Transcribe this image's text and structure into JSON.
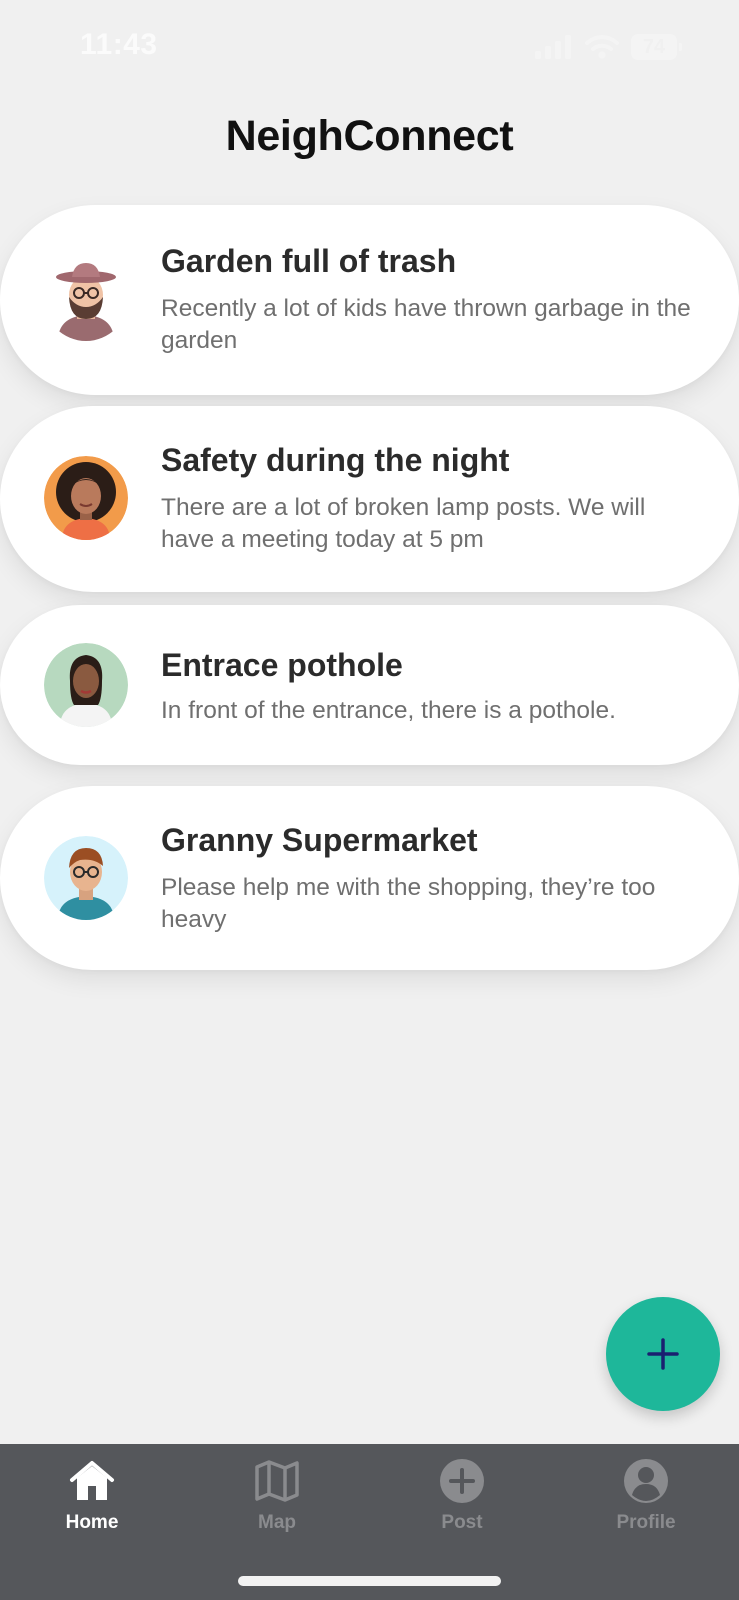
{
  "status_bar": {
    "time": "11:43",
    "battery": "74"
  },
  "app": {
    "title": "NeighConnect"
  },
  "posts": [
    {
      "title": "Garden full of trash",
      "body": "Recently a lot of kids have thrown garbage in the garden"
    },
    {
      "title": "Safety during the night",
      "body": "There are a lot of broken lamp posts. We will have a meeting today at 5 pm"
    },
    {
      "title": "Entrace pothole",
      "body": "In front of the entrance, there is a pothole."
    },
    {
      "title": "Granny Supermarket",
      "body": "Please help me with the shopping, they’re too heavy"
    }
  ],
  "fab": {
    "icon": "plus-icon",
    "color": "#1eb79a",
    "icon_color": "#1a2070"
  },
  "tabs": [
    {
      "label": "Home",
      "icon": "home-icon",
      "active": true
    },
    {
      "label": "Map",
      "icon": "map-icon",
      "active": false
    },
    {
      "label": "Post",
      "icon": "plus-circle-icon",
      "active": false
    },
    {
      "label": "Profile",
      "icon": "user-circle-icon",
      "active": false
    }
  ],
  "colors": {
    "background": "#f0f0f0",
    "card": "#ffffff",
    "tab_bar": "#55575b",
    "tab_active": "#ffffff",
    "tab_inactive": "#8a8b8e"
  }
}
